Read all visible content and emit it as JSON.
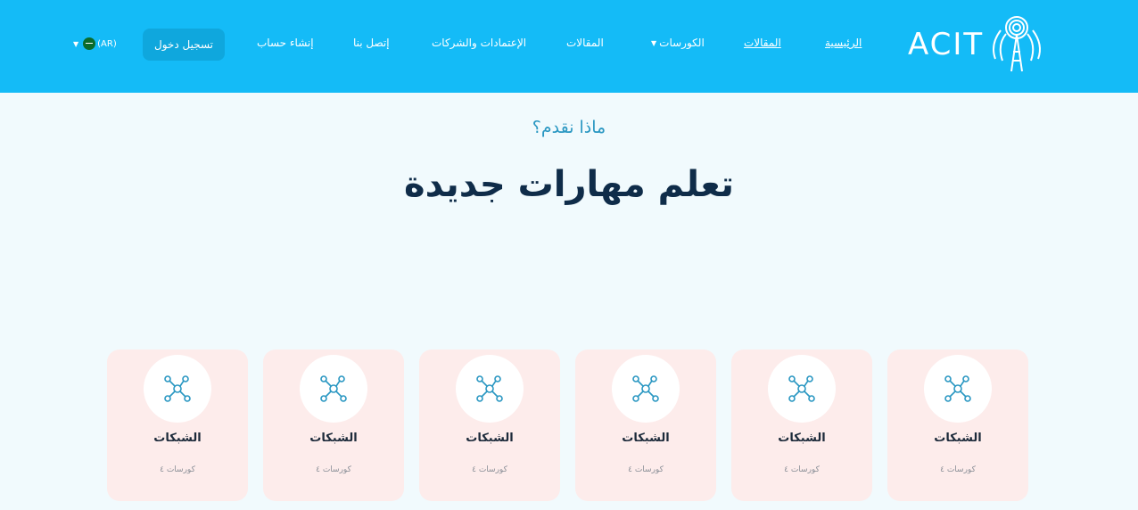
{
  "header": {
    "logo_text": "ACIT",
    "nav": {
      "home": "الرئيسية",
      "articles_underlined": "المقالات",
      "courses": "الكورسات",
      "articles": "المقالات",
      "accreditations": "الإعتمادات والشركات",
      "contact": "إتصل بنا",
      "register": "إنشاء حساب"
    },
    "login_label": "تسجيل دخول",
    "language": "(AR)"
  },
  "hero": {
    "subtitle": "ماذا نقدم؟",
    "title": "تعلم مهارات جديدة"
  },
  "categories": [
    {
      "title": "الشبكات",
      "count": "كورسات ٤",
      "icon": "network-icon"
    },
    {
      "title": "الشبكات",
      "count": "كورسات ٤",
      "icon": "network-icon"
    },
    {
      "title": "الشبكات",
      "count": "كورسات ٤",
      "icon": "network-icon"
    },
    {
      "title": "الشبكات",
      "count": "كورسات ٤",
      "icon": "network-icon"
    },
    {
      "title": "الشبكات",
      "count": "كورسات ٤",
      "icon": "network-icon"
    },
    {
      "title": "الشبكات",
      "count": "كورسات ٤",
      "icon": "network-icon"
    }
  ],
  "colors": {
    "header": "#14bbf7",
    "card": "#fdeceb",
    "accent": "#2a97c2",
    "title": "#0f2c49"
  }
}
